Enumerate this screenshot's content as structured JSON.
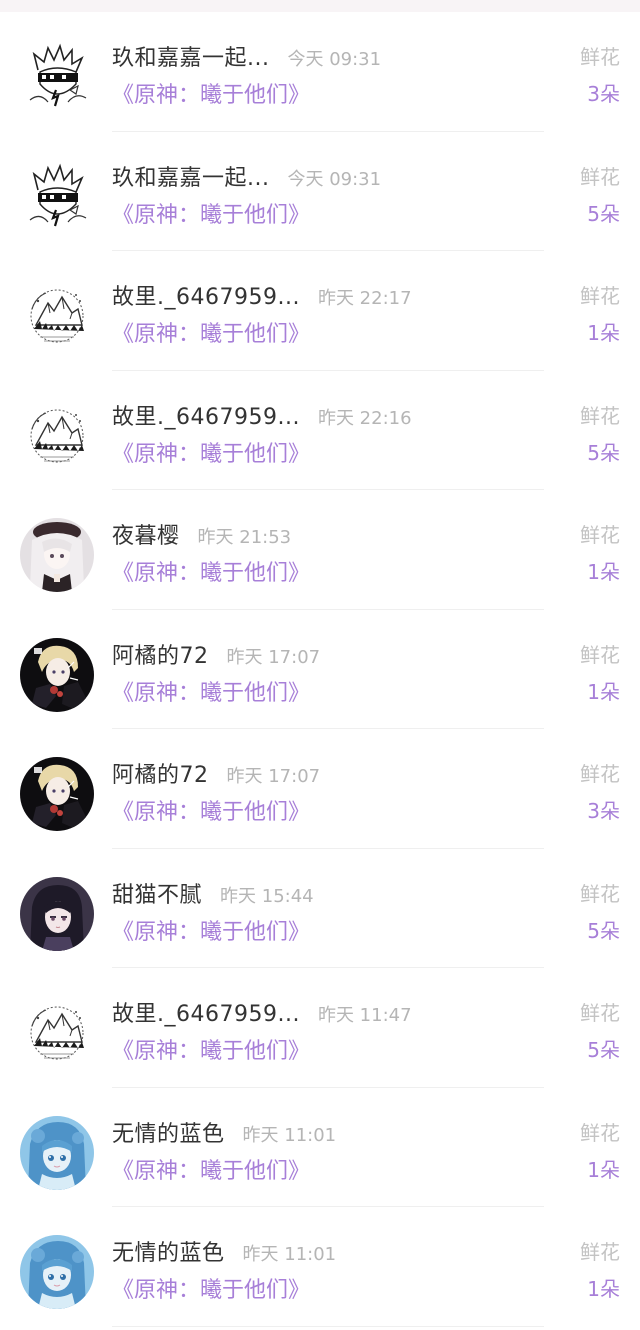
{
  "rows": [
    {
      "user": "玖和嘉嘉一起...",
      "time": "今天 09:31",
      "book": "《原神：曦于他们》",
      "gift": "鲜花",
      "count": "3朵",
      "avatar_icon": "sketch-boy-avatar-icon"
    },
    {
      "user": "玖和嘉嘉一起...",
      "time": "今天 09:31",
      "book": "《原神：曦于他们》",
      "gift": "鲜花",
      "count": "5朵",
      "avatar_icon": "sketch-boy-avatar-icon"
    },
    {
      "user": "故里._6467959...",
      "time": "昨天 22:17",
      "book": "《原神：曦于他们》",
      "gift": "鲜花",
      "count": "1朵",
      "avatar_icon": "mountain-sketch-avatar-icon"
    },
    {
      "user": "故里._6467959...",
      "time": "昨天 22:16",
      "book": "《原神：曦于他们》",
      "gift": "鲜花",
      "count": "5朵",
      "avatar_icon": "mountain-sketch-avatar-icon"
    },
    {
      "user": "夜暮樱",
      "time": "昨天 21:53",
      "book": "《原神：曦于他们》",
      "gift": "鲜花",
      "count": "1朵",
      "avatar_icon": "white-hair-girl-avatar-icon"
    },
    {
      "user": "阿橘的72",
      "time": "昨天 17:07",
      "book": "《原神：曦于他们》",
      "gift": "鲜花",
      "count": "1朵",
      "avatar_icon": "blonde-boy-avatar-icon"
    },
    {
      "user": "阿橘的72",
      "time": "昨天 17:07",
      "book": "《原神：曦于他们》",
      "gift": "鲜花",
      "count": "3朵",
      "avatar_icon": "blonde-boy-avatar-icon"
    },
    {
      "user": "甜猫不腻",
      "time": "昨天 15:44",
      "book": "《原神：曦于他们》",
      "gift": "鲜花",
      "count": "5朵",
      "avatar_icon": "dark-hair-girl-avatar-icon"
    },
    {
      "user": "故里._6467959...",
      "time": "昨天 11:47",
      "book": "《原神：曦于他们》",
      "gift": "鲜花",
      "count": "5朵",
      "avatar_icon": "mountain-sketch-avatar-icon"
    },
    {
      "user": "无情的蓝色",
      "time": "昨天 11:01",
      "book": "《原神：曦于他们》",
      "gift": "鲜花",
      "count": "1朵",
      "avatar_icon": "blue-hair-girl-avatar-icon"
    },
    {
      "user": "无情的蓝色",
      "time": "昨天 11:01",
      "book": "《原神：曦于他们》",
      "gift": "鲜花",
      "count": "1朵",
      "avatar_icon": "blue-hair-girl-avatar-icon"
    }
  ],
  "colors": {
    "accent": "#a77fd8",
    "name": "#333333",
    "muted": "#b5b5b5",
    "gift_label": "#c3c3c3"
  }
}
